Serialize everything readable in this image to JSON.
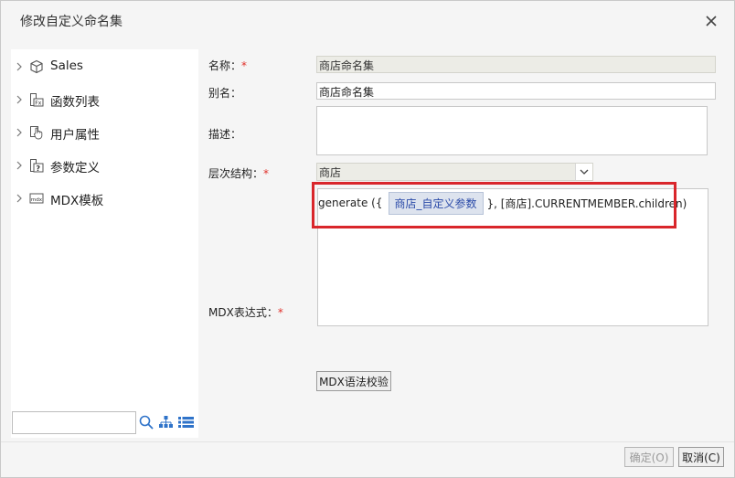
{
  "dialog": {
    "title": "修改自定义命名集"
  },
  "tree": {
    "items": [
      {
        "label": "Sales",
        "icon": "cube-icon"
      },
      {
        "label": "函数列表",
        "icon": "function-icon"
      },
      {
        "label": "用户属性",
        "icon": "user-property-icon"
      },
      {
        "label": "参数定义",
        "icon": "parameter-icon"
      },
      {
        "label": "MDX模板",
        "icon": "mdx-template-icon"
      }
    ],
    "search_value": ""
  },
  "form": {
    "name_label": "名称：",
    "name_value": "商店命名集",
    "alias_label": "别名：",
    "alias_value": "商店命名集",
    "desc_label": "描述：",
    "desc_value": "",
    "hierarchy_label": "层次结构：",
    "hierarchy_value": "商店",
    "mdx_label": "MDX表达式：",
    "required_mark": "*",
    "mdx_prefix": "generate ({",
    "mdx_param": "商店_自定义参数",
    "mdx_suffix": "}, [商店].CURRENTMEMBER.children)",
    "validate_label": "MDX语法校验"
  },
  "footer": {
    "ok_label": "确定(O)",
    "cancel_label": "取消(C)"
  },
  "colors": {
    "highlight": "#d9262b",
    "required": "#e0302a",
    "param_chip_text": "#2a4aa8"
  }
}
